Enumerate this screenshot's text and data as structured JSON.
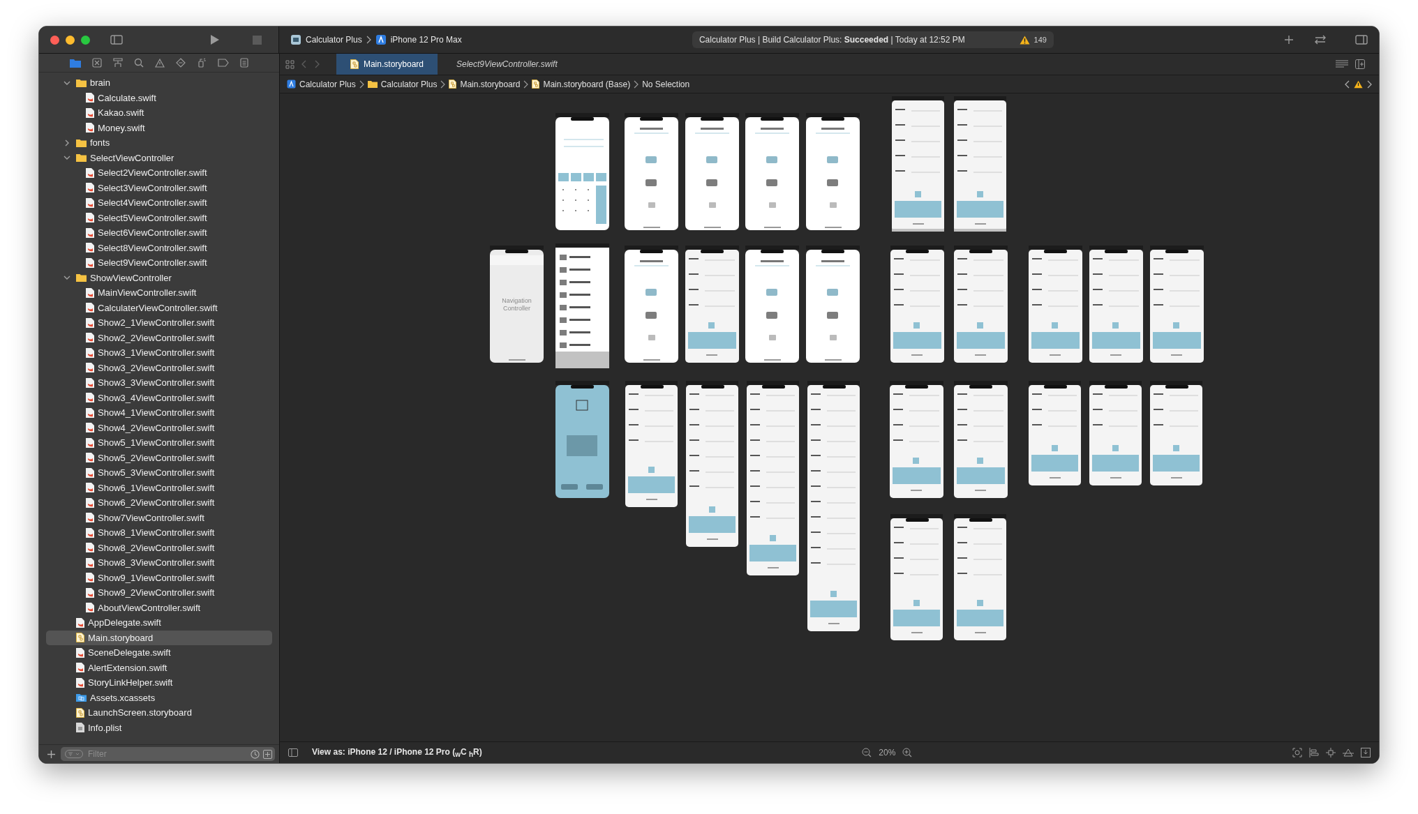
{
  "window": {
    "scheme": {
      "project": "Calculator Plus",
      "device": "iPhone 12 Pro Max"
    },
    "status": "Calculator Plus | Build Calculator Plus: **Succeeded** | Today at 12:52 PM",
    "warnings": "149"
  },
  "sidebar": {
    "items": [
      {
        "name": "brain",
        "kind": "folder",
        "expanded": true,
        "selected": false,
        "children": [
          {
            "name": "Calculate.swift",
            "kind": "swift",
            "selected": false
          },
          {
            "name": "Kakao.swift",
            "kind": "swift",
            "selected": false
          },
          {
            "name": "Money.swift",
            "kind": "swift",
            "selected": false
          }
        ]
      },
      {
        "name": "fonts",
        "kind": "folder",
        "expanded": false,
        "selected": false
      },
      {
        "name": "SelectViewController",
        "kind": "folder",
        "expanded": true,
        "selected": false,
        "children": [
          {
            "name": "Select2ViewController.swift",
            "kind": "swift",
            "selected": false
          },
          {
            "name": "Select3ViewController.swift",
            "kind": "swift",
            "selected": false
          },
          {
            "name": "Select4ViewController.swift",
            "kind": "swift",
            "selected": false
          },
          {
            "name": "Select5ViewController.swift",
            "kind": "swift",
            "selected": false
          },
          {
            "name": "Select6ViewController.swift",
            "kind": "swift",
            "selected": false
          },
          {
            "name": "Select8ViewController.swift",
            "kind": "swift",
            "selected": false
          },
          {
            "name": "Select9ViewController.swift",
            "kind": "swift",
            "selected": false
          }
        ]
      },
      {
        "name": "ShowViewController",
        "kind": "folder",
        "expanded": true,
        "selected": false,
        "children": [
          {
            "name": "MainViewController.swift",
            "kind": "swift",
            "selected": false
          },
          {
            "name": "CalculaterViewController.swift",
            "kind": "swift",
            "selected": false
          },
          {
            "name": "Show2_1ViewController.swift",
            "kind": "swift",
            "selected": false
          },
          {
            "name": "Show2_2ViewController.swift",
            "kind": "swift",
            "selected": false
          },
          {
            "name": "Show3_1ViewController.swift",
            "kind": "swift",
            "selected": false
          },
          {
            "name": "Show3_2ViewController.swift",
            "kind": "swift",
            "selected": false
          },
          {
            "name": "Show3_3ViewController.swift",
            "kind": "swift",
            "selected": false
          },
          {
            "name": "Show3_4ViewController.swift",
            "kind": "swift",
            "selected": false
          },
          {
            "name": "Show4_1ViewController.swift",
            "kind": "swift",
            "selected": false
          },
          {
            "name": "Show4_2ViewController.swift",
            "kind": "swift",
            "selected": false
          },
          {
            "name": "Show5_1ViewController.swift",
            "kind": "swift",
            "selected": false
          },
          {
            "name": "Show5_2ViewController.swift",
            "kind": "swift",
            "selected": false
          },
          {
            "name": "Show5_3ViewController.swift",
            "kind": "swift",
            "selected": false
          },
          {
            "name": "Show6_1ViewController.swift",
            "kind": "swift",
            "selected": false
          },
          {
            "name": "Show6_2ViewController.swift",
            "kind": "swift",
            "selected": false
          },
          {
            "name": "Show7ViewController.swift",
            "kind": "swift",
            "selected": false
          },
          {
            "name": "Show8_1ViewController.swift",
            "kind": "swift",
            "selected": false
          },
          {
            "name": "Show8_2ViewController.swift",
            "kind": "swift",
            "selected": false
          },
          {
            "name": "Show8_3ViewController.swift",
            "kind": "swift",
            "selected": false
          },
          {
            "name": "Show9_1ViewController.swift",
            "kind": "swift",
            "selected": false
          },
          {
            "name": "Show9_2ViewController.swift",
            "kind": "swift",
            "selected": false
          },
          {
            "name": "AboutViewController.swift",
            "kind": "swift",
            "selected": false
          }
        ]
      },
      {
        "name": "AppDelegate.swift",
        "kind": "swift",
        "selected": false
      },
      {
        "name": "Main.storyboard",
        "kind": "storyboard",
        "selected": true
      },
      {
        "name": "SceneDelegate.swift",
        "kind": "swift",
        "selected": false
      },
      {
        "name": "AlertExtension.swift",
        "kind": "swift",
        "selected": false
      },
      {
        "name": "StoryLinkHelper.swift",
        "kind": "swift",
        "selected": false
      },
      {
        "name": "Assets.xcassets",
        "kind": "assets",
        "selected": false
      },
      {
        "name": "LaunchScreen.storyboard",
        "kind": "storyboard",
        "selected": false
      },
      {
        "name": "Info.plist",
        "kind": "plist",
        "selected": false
      }
    ],
    "filter": {
      "placeholder": "Filter"
    }
  },
  "tabs": [
    {
      "label": "Main.storyboard",
      "kind": "storyboard",
      "selected": true,
      "preview": false
    },
    {
      "label": "Select9ViewController.swift",
      "kind": "swift",
      "selected": false,
      "preview": true
    }
  ],
  "jump_bar": [
    {
      "label": "Calculator Plus",
      "kind": "project"
    },
    {
      "label": "Calculator Plus",
      "kind": "folder"
    },
    {
      "label": "Main.storyboard",
      "kind": "storyboard"
    },
    {
      "label": "Main.storyboard (Base)",
      "kind": "storyboard"
    },
    {
      "label": "No Selection",
      "kind": "none"
    }
  ],
  "canvas": {
    "scenes": [
      {
        "kind": "calculator"
      },
      {
        "kind": "icons"
      },
      {
        "kind": "icons"
      },
      {
        "kind": "icons"
      },
      {
        "kind": "icons"
      },
      {
        "kind": "tall"
      },
      {
        "kind": "tall"
      },
      {
        "kind": "navigation",
        "label": "Navigation Controller"
      },
      {
        "kind": "menu"
      },
      {
        "kind": "icons"
      },
      {
        "kind": "form"
      },
      {
        "kind": "icons"
      },
      {
        "kind": "icons"
      },
      {
        "kind": "form"
      },
      {
        "kind": "form"
      },
      {
        "kind": "form"
      },
      {
        "kind": "form"
      },
      {
        "kind": "form"
      },
      {
        "kind": "about"
      },
      {
        "kind": "form"
      },
      {
        "kind": "form"
      },
      {
        "kind": "form"
      },
      {
        "kind": "form"
      },
      {
        "kind": "form"
      },
      {
        "kind": "form"
      },
      {
        "kind": "form"
      },
      {
        "kind": "form"
      },
      {
        "kind": "form"
      },
      {
        "kind": "form"
      },
      {
        "kind": "form"
      }
    ]
  },
  "bottom_bar": {
    "view_as": "View as: iPhone 12 / iPhone 12 Pro ($_{w}$C $_{h}$R)",
    "zoom": "20%"
  }
}
